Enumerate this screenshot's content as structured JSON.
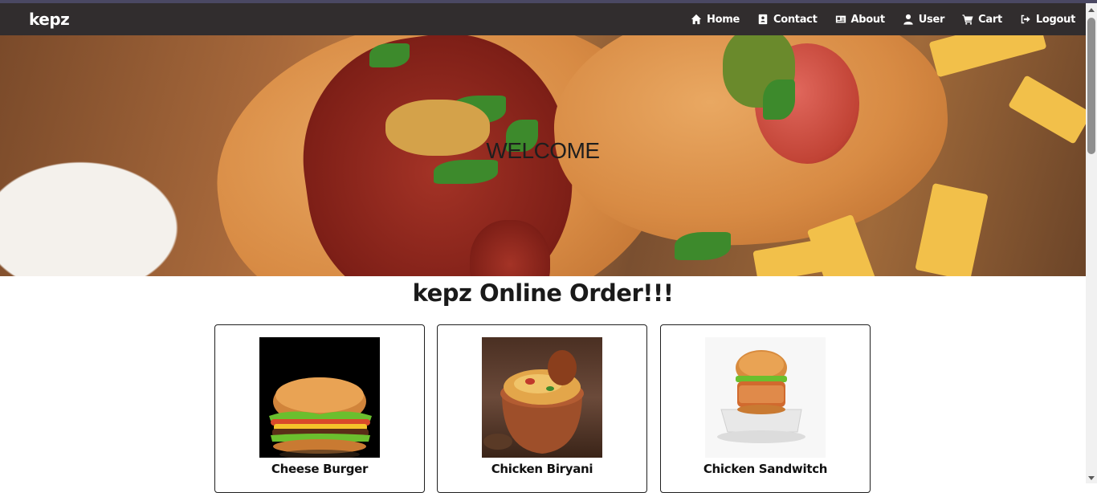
{
  "navbar": {
    "brand": "kepz",
    "links": [
      {
        "label": "Home",
        "icon": "home-icon"
      },
      {
        "label": "Contact",
        "icon": "contact-card-icon"
      },
      {
        "label": "About",
        "icon": "id-card-icon"
      },
      {
        "label": "User",
        "icon": "user-icon"
      },
      {
        "label": "Cart",
        "icon": "cart-icon"
      },
      {
        "label": "Logout",
        "icon": "logout-icon"
      }
    ]
  },
  "hero": {
    "title": "WELCOME",
    "image": "hot-dogs-with-fries-and-mustard"
  },
  "main": {
    "heading": "kepz Online Order!!!",
    "products": [
      {
        "name": "Cheese Burger",
        "image": "cheese-burger-photo"
      },
      {
        "name": "Chicken Biryani",
        "image": "chicken-biryani-photo"
      },
      {
        "name": "Chicken Sandwitch",
        "image": "chicken-sandwich-photo"
      }
    ]
  },
  "colors": {
    "navbar_bg": "#312d2e",
    "nav_text": "#ffffff",
    "card_border": "#1f1f1f"
  }
}
